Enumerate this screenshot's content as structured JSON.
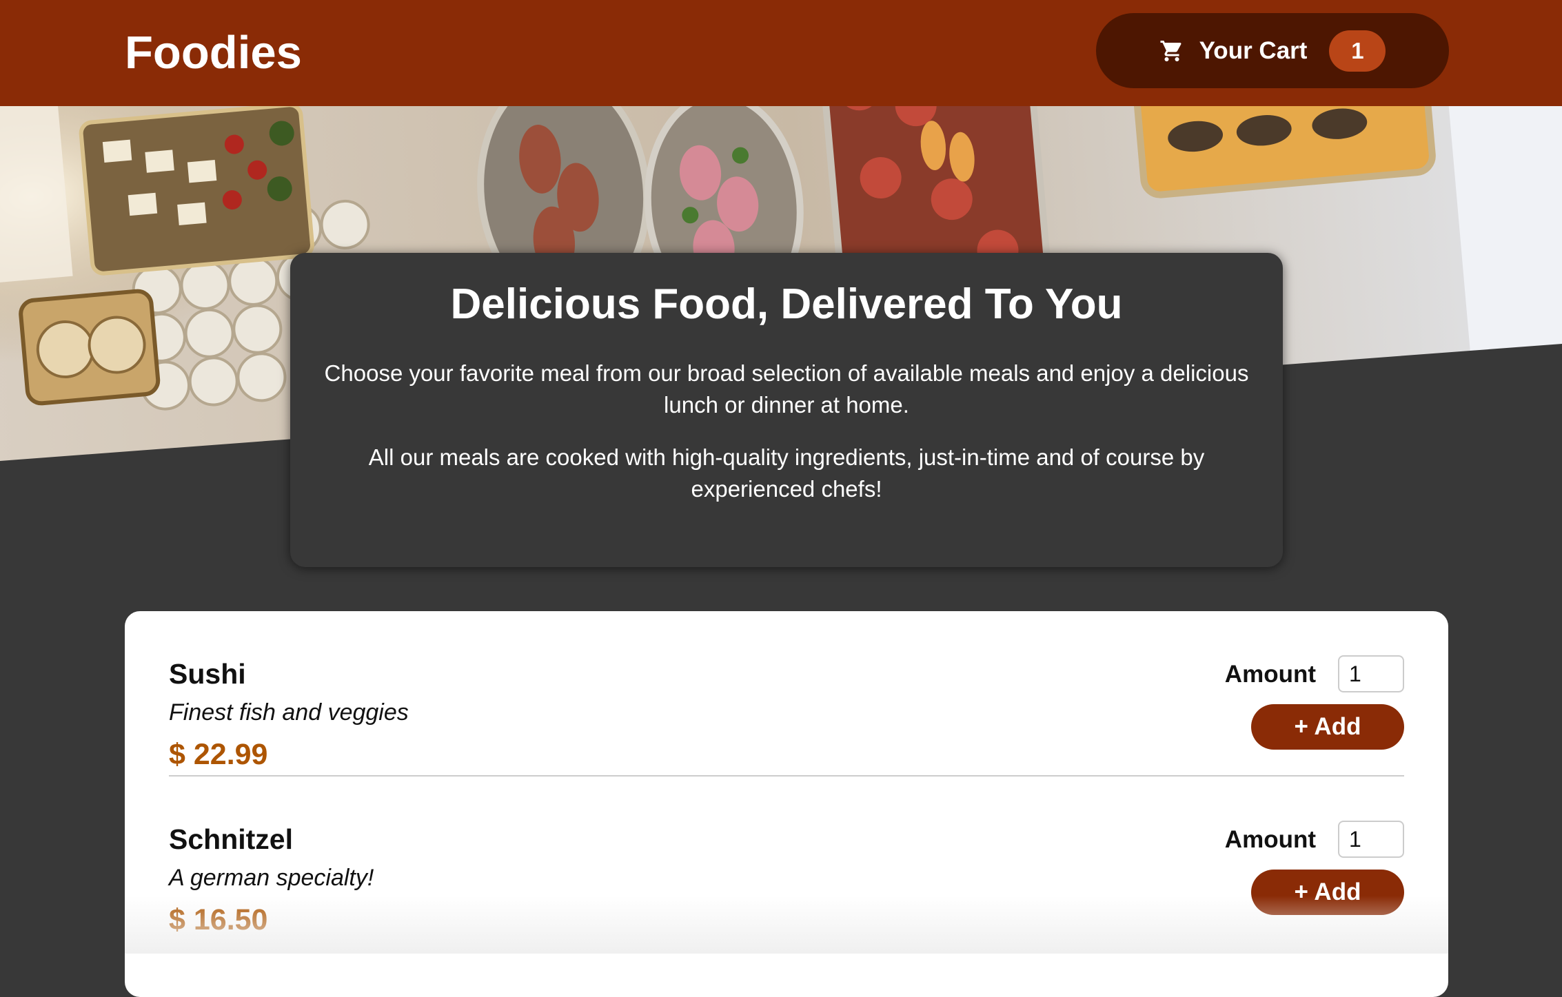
{
  "header": {
    "brand": "Foodies",
    "cart_label": "Your Cart",
    "cart_count": "1",
    "cart_icon": "shopping-cart-icon"
  },
  "colors": {
    "header_bg": "#8a2b06",
    "cart_button_bg": "#4d1601",
    "badge_bg": "#b94517",
    "page_bg": "#383838",
    "price": "#ad5502"
  },
  "summary": {
    "title": "Delicious Food, Delivered To You",
    "paragraph1": "Choose your favorite meal from our broad selection of available meals and enjoy a delicious lunch or dinner at home.",
    "paragraph2": "All our meals are cooked with high-quality ingredients, just-in-time and of course by experienced chefs!"
  },
  "meals": [
    {
      "name": "Sushi",
      "description": "Finest fish and veggies",
      "price": "$ 22.99",
      "amount_label": "Amount",
      "amount_value": "1",
      "add_label": "+ Add"
    },
    {
      "name": "Schnitzel",
      "description": "A german specialty!",
      "price": "$ 16.50",
      "amount_label": "Amount",
      "amount_value": "1",
      "add_label": "+ Add"
    }
  ]
}
